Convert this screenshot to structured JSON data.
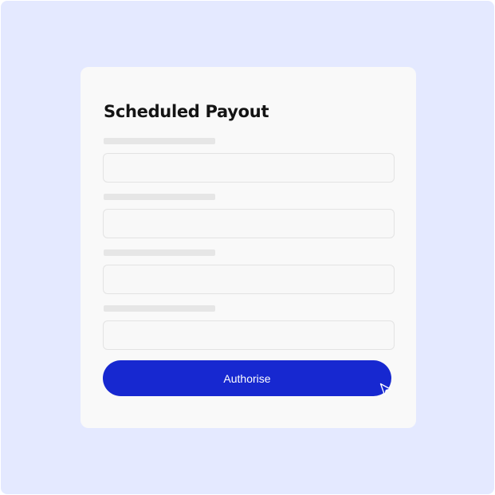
{
  "form": {
    "title": "Scheduled Payout",
    "submit_label": "Authorise",
    "fields": [
      {
        "value": ""
      },
      {
        "value": ""
      },
      {
        "value": ""
      },
      {
        "value": ""
      }
    ]
  },
  "colors": {
    "background": "#e4e9ff",
    "card": "#f9f9f9",
    "accent": "#1728d0",
    "title_text": "#141414",
    "placeholder_bar": "#e6e6e6"
  },
  "icons": {
    "cursor": "mouse-pointer-icon"
  }
}
